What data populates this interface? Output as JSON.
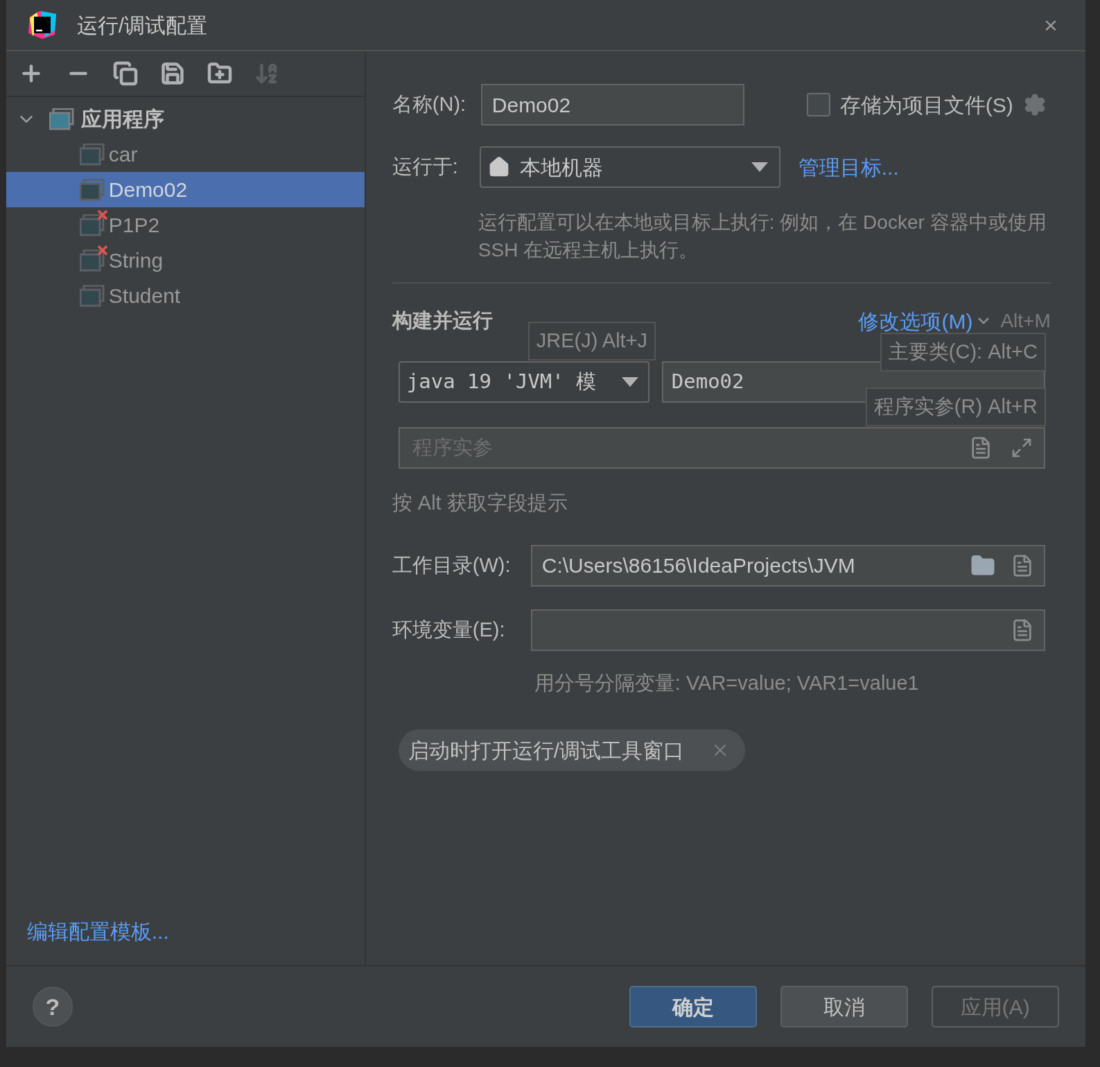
{
  "window": {
    "title": "运行/调试配置",
    "close": "×"
  },
  "toolbar": [
    {
      "kind": "add",
      "disabled": false
    },
    {
      "kind": "remove",
      "disabled": false
    },
    {
      "kind": "copy",
      "disabled": false
    },
    {
      "kind": "save",
      "disabled": false
    },
    {
      "kind": "folder",
      "disabled": false
    },
    {
      "kind": "sort",
      "disabled": true
    }
  ],
  "tree": [
    {
      "label": "应用程序",
      "expanded": true,
      "selected": false,
      "children": [
        {
          "label": "car",
          "selected": false,
          "error": false
        },
        {
          "label": "Demo02",
          "selected": true,
          "error": false
        },
        {
          "label": "P1P2",
          "selected": false,
          "error": true
        },
        {
          "label": "String",
          "selected": false,
          "error": true
        },
        {
          "label": "Student",
          "selected": false,
          "error": false
        }
      ]
    }
  ],
  "edit_templates_link": "编辑配置模板...",
  "form": {
    "name_label": "名称(N):",
    "name_value": "Demo02",
    "store_checkbox": {
      "label": "存储为项目文件(S)",
      "checked": false
    },
    "run_on_label": "运行于:",
    "run_on_value": "本地机器",
    "manage_targets_link": "管理目标...",
    "run_on_hint": "运行配置可以在本地或目标上执行: 例如，在 Docker 容器中或使用 SSH 在远程主机上执行。"
  },
  "build": {
    "title": "构建并运行",
    "modify_link": "修改选项(M)",
    "modify_shortcut": "Alt+M",
    "jre_value": "java 19 'JVM' 模",
    "main_class_value": "Demo02",
    "args_placeholder": "程序实参",
    "tooltips": [
      {
        "kind": "jre",
        "text": "JRE(J) Alt+J"
      },
      {
        "kind": "main",
        "text": "主要类(C): Alt+C"
      },
      {
        "kind": "args",
        "text": "程序实参(R) Alt+R"
      }
    ],
    "alt_hint": "按 Alt 获取字段提示",
    "workdir_label": "工作目录(W):",
    "workdir_value": "C:\\Users\\86156\\IdeaProjects\\JVM",
    "env_label": "环境变量(E):",
    "env_hint": "用分号分隔变量: VAR=value; VAR1=value1",
    "chip": "启动时打开运行/调试工具窗口"
  },
  "help": "?",
  "buttons": [
    {
      "label": "确定",
      "kind": "primary",
      "disabled": false
    },
    {
      "label": "取消",
      "kind": "normal",
      "disabled": false
    },
    {
      "label": "应用(A)",
      "kind": "normal",
      "disabled": true
    }
  ]
}
